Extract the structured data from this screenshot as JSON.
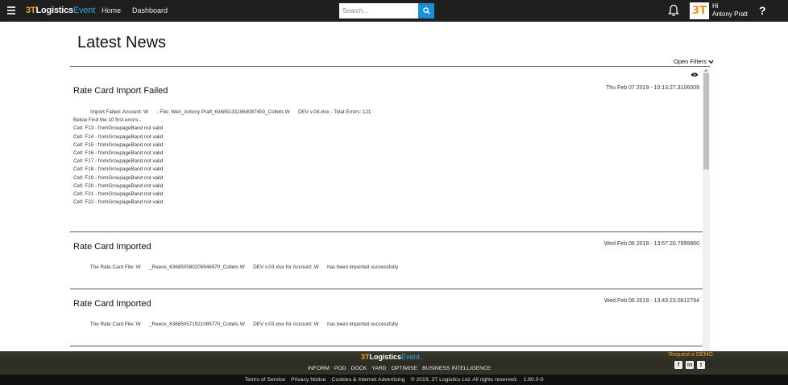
{
  "header": {
    "brand_3t": "3T",
    "brand_logistics": "Logistics",
    "brand_event": "Event",
    "nav": [
      "Home",
      "Dashboard"
    ],
    "search_placeholder": "Search...",
    "avatar_text": "3T",
    "greeting_hi": "Hi",
    "greeting_name": "Antony Pratt",
    "help": "?"
  },
  "page": {
    "title": "Latest News",
    "open_filters": "Open Filters"
  },
  "news": [
    {
      "title": "Rate Card Import Failed",
      "date": "Thu Feb 07 2019 - 10:13:27.3106009",
      "body": "            Import Failed: Account: W      - File: Weir_Antony Pratt_636851311968087450_Collets W      DEV v.04.xlsx - Total Errors: 121\nBelow Find the 10 first errors..\nCell: F13 - fromGroupageBand not valid\nCell: F14 - fromGroupageBand not valid\nCell: F15 - fromGroupageBand not valid\nCell: F16 - fromGroupageBand not valid\nCell: F17 - fromGroupageBand not valid\nCell: F18 - fromGroupageBand not valid\nCell: F19 - fromGroupageBand not valid\nCell: F20 - fromGroupageBand not valid\nCell: F21 - fromGroupageBand not valid\nCell: F22 - fromGroupageBand not valid"
    },
    {
      "title": "Rate Card Imported",
      "date": "Wed Feb 06 2019 - 13:57:20.7999860",
      "body": "            The Rate Card File: W      _Reece_636850580205946970_Collets W      DEV v.03.xlsx for Account: W      has been imported successfully"
    },
    {
      "title": "Rate Card Imported",
      "date": "Wed Feb 06 2019 - 13:43:23.0812784",
      "body": "            The Rate Card File: W      _Reece_636850571921085770_Collets W      DEV v.03.xlsx for Account: W      has been imported successfully"
    }
  ],
  "footer": {
    "brand_3t": "3T",
    "brand_logistics": "Logistics",
    "brand_event": "Event.",
    "links": [
      "INFORM",
      "POD",
      "DOCK",
      "YARD",
      "OPTIMISE",
      "BUSINESS INTELLIGENCE"
    ],
    "request_demo": "Request a DEMO",
    "social": [
      "f",
      "in",
      "t"
    ],
    "bottom": [
      "Terms of Service",
      "Privacy Notice",
      "Cookies & Internet Advertising",
      "© 2019, 3T Logistics Ltd. All rights reserved.",
      "1.60.0-0"
    ]
  },
  "colors": {
    "navbar": "#1f1f1f",
    "accent_orange": "#f0a526",
    "accent_blue": "#1a8fd6"
  }
}
